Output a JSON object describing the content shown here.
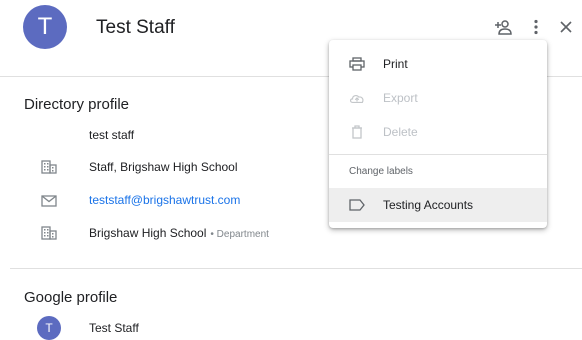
{
  "header": {
    "avatar_letter": "T",
    "name": "Test Staff",
    "icons": [
      "add-to-contacts-icon",
      "more-vert-icon",
      "close-icon"
    ]
  },
  "directory": {
    "title": "Directory profile",
    "name": "test staff",
    "job": "Staff, Brigshaw High School",
    "email": "teststaff@brigshawtrust.com",
    "department": "Brigshaw High School",
    "department_label": "• Department"
  },
  "google": {
    "title": "Google profile",
    "avatar_letter": "T",
    "name": "Test Staff"
  },
  "menu": {
    "print": "Print",
    "export": "Export",
    "delete": "Delete",
    "change_labels": "Change labels",
    "label": "Testing Accounts"
  },
  "colors": {
    "avatar": "#5c6bc0",
    "link": "#1a73e8",
    "hover": "#eeeeee"
  }
}
